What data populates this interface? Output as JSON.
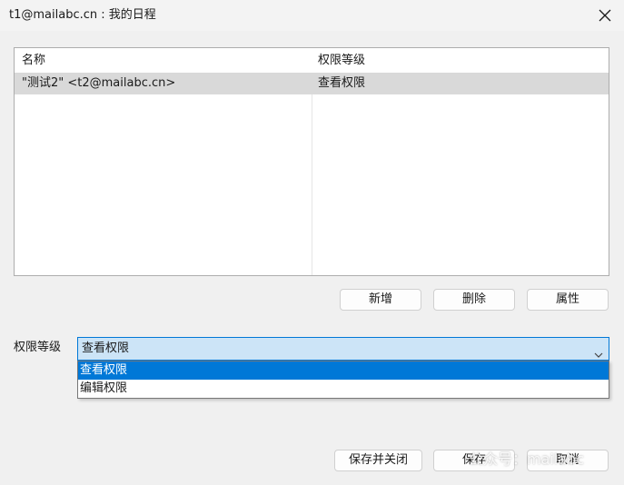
{
  "window": {
    "title": "t1@mailabc.cn : 我的日程"
  },
  "list": {
    "columns": [
      "名称",
      "权限等级"
    ],
    "rows": [
      {
        "name": "\"测试2\" <t2@mailabc.cn>",
        "permission": "查看权限",
        "selected": true
      }
    ]
  },
  "list_buttons": {
    "add": "新增",
    "delete": "删除",
    "properties": "属性"
  },
  "permission": {
    "label": "权限等级",
    "selected": "查看权限",
    "options": [
      "查看权限",
      "编辑权限"
    ]
  },
  "footer_buttons": {
    "save_close": "保存并关闭",
    "save": "保存",
    "cancel": "取消"
  },
  "watermark": {
    "text": "公众号：mailabc"
  },
  "colors": {
    "accent": "#0078d7",
    "combo_bg": "#cce4f7",
    "row_selected_bg": "#d9d9d9",
    "window_bg": "#f0f0f0"
  }
}
